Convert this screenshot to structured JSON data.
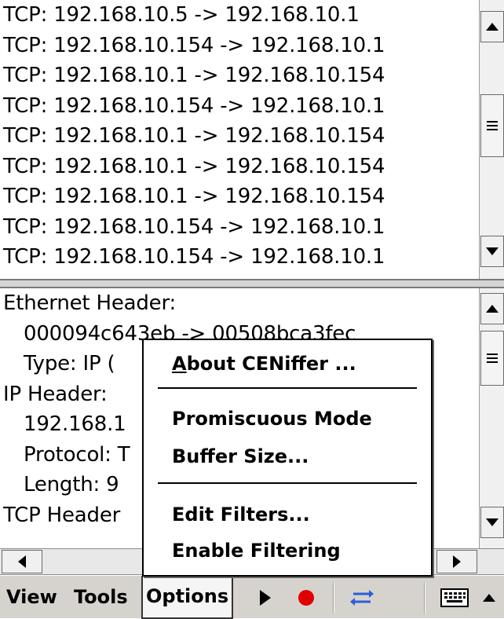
{
  "packet_list": [
    "TCP: 192.168.10.5 -> 192.168.10.1",
    "TCP: 192.168.10.154 -> 192.168.10.1",
    "TCP: 192.168.10.1 -> 192.168.10.154",
    "TCP: 192.168.10.154 -> 192.168.10.1",
    "TCP: 192.168.10.1 -> 192.168.10.154",
    "TCP: 192.168.10.1 -> 192.168.10.154",
    "TCP: 192.168.10.1 -> 192.168.10.154",
    "TCP: 192.168.10.154 -> 192.168.10.1",
    "TCP: 192.168.10.154 -> 192.168.10.1"
  ],
  "details": {
    "ethernet_header": "Ethernet Header:",
    "mac_line": "000094c643eb -> 00508bca3fec",
    "type_line": "Type: IP (",
    "ip_header": "IP Header:",
    "ip_line": "192.168.1",
    "protocol_line": "Protocol: T",
    "length_line": "Length: 9",
    "tcp_header": "TCP Header"
  },
  "popup_menu": {
    "about_prefix": "A",
    "about_rest": "bout CENiffer ...",
    "promiscuous": "Promiscuous Mode",
    "buffer_size": "Buffer Size...",
    "edit_filters": "Edit Filters...",
    "enable_filtering": "Enable Filtering"
  },
  "menubar": {
    "view": "View",
    "tools": "Tools",
    "options": "Options"
  },
  "icons": {
    "play": "play-icon",
    "record": "record-icon",
    "swap": "swap-arrows-icon",
    "keyboard": "keyboard-icon",
    "sip_arrow": "chevron-up-icon"
  },
  "colors": {
    "record": "#e00000",
    "swap": "#2a5fd8",
    "menubar": "#d6d3ce"
  }
}
